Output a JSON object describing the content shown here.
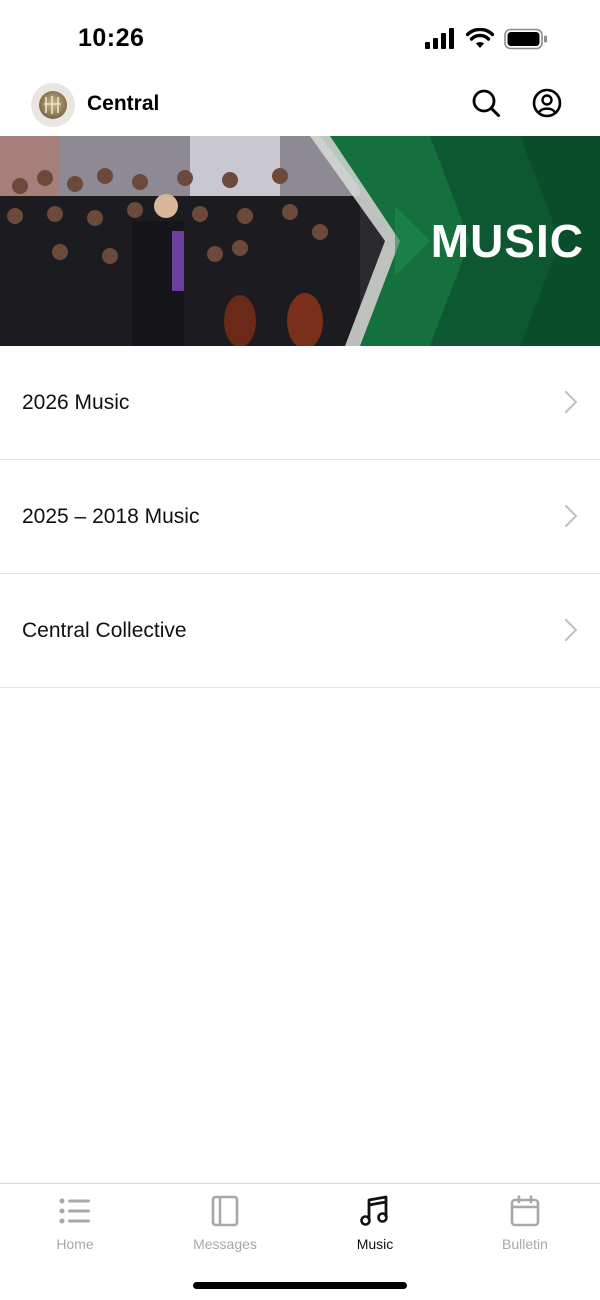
{
  "status_bar": {
    "time": "10:26",
    "icons": [
      "signal-icon",
      "wifi-icon",
      "battery-icon"
    ]
  },
  "header": {
    "title": "Central",
    "logo_icon": "church-logo-icon",
    "actions": [
      "search-icon",
      "profile-icon"
    ]
  },
  "banner": {
    "text": "MUSIC",
    "accent_color": "#0f6b3a",
    "dark_green": "#0a4d2a"
  },
  "list": {
    "items": [
      {
        "label": "2026 Music"
      },
      {
        "label": "2025 – 2018 Music"
      },
      {
        "label": "Central Collective"
      }
    ]
  },
  "tab_bar": {
    "active": "Music",
    "tabs": [
      {
        "label": "Home",
        "icon": "list-icon"
      },
      {
        "label": "Messages",
        "icon": "book-icon"
      },
      {
        "label": "Music",
        "icon": "music-note-icon"
      },
      {
        "label": "Bulletin",
        "icon": "calendar-icon"
      }
    ]
  }
}
